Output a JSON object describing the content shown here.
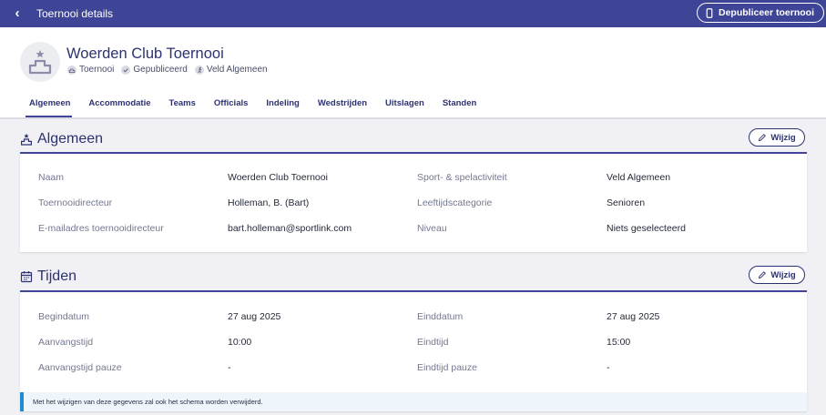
{
  "topbar": {
    "back": "‹",
    "title": "Toernooi details",
    "depublish_label": "Depubliceer toernooi"
  },
  "tournament": {
    "name": "Woerden Club Toernooi",
    "type": "Toernooi",
    "status": "Gepubliceerd",
    "sport": "Veld Algemeen"
  },
  "tabs": [
    "Algemeen",
    "Accommodatie",
    "Teams",
    "Officials",
    "Indeling",
    "Wedstrijden",
    "Uitslagen",
    "Standen"
  ],
  "algemeen": {
    "title": "Algemeen",
    "edit_label": "Wijzig",
    "rows": [
      {
        "l1": "Naam",
        "v1": "Woerden Club Toernooi",
        "l2": "Sport- & spelactiviteit",
        "v2": "Veld Algemeen"
      },
      {
        "l1": "Toernooidirecteur",
        "v1": "Holleman, B. (Bart)",
        "l2": "Leeftijdscategorie",
        "v2": "Senioren"
      },
      {
        "l1": "E-mailadres toernooidirecteur",
        "v1": "bart.holleman@sportlink.com",
        "l2": "Niveau",
        "v2": "Niets geselecteerd"
      }
    ]
  },
  "tijden": {
    "title": "Tijden",
    "edit_label": "Wijzig",
    "rows": [
      {
        "l1": "Begindatum",
        "v1": "27 aug 2025",
        "l2": "Einddatum",
        "v2": "27 aug 2025"
      },
      {
        "l1": "Aanvangstijd",
        "v1": "10:00",
        "l2": "Eindtijd",
        "v2": "15:00"
      },
      {
        "l1": "Aanvangstijd pauze",
        "v1": "-",
        "l2": "Eindtijd pauze",
        "v2": "-"
      }
    ],
    "note": "Met het wijzigen van deze gegevens zal ook het schema worden verwijderd."
  },
  "colors": {
    "primary": "#3f4596",
    "accent_info": "#1f8ccf",
    "background": "#f1f1f5"
  }
}
